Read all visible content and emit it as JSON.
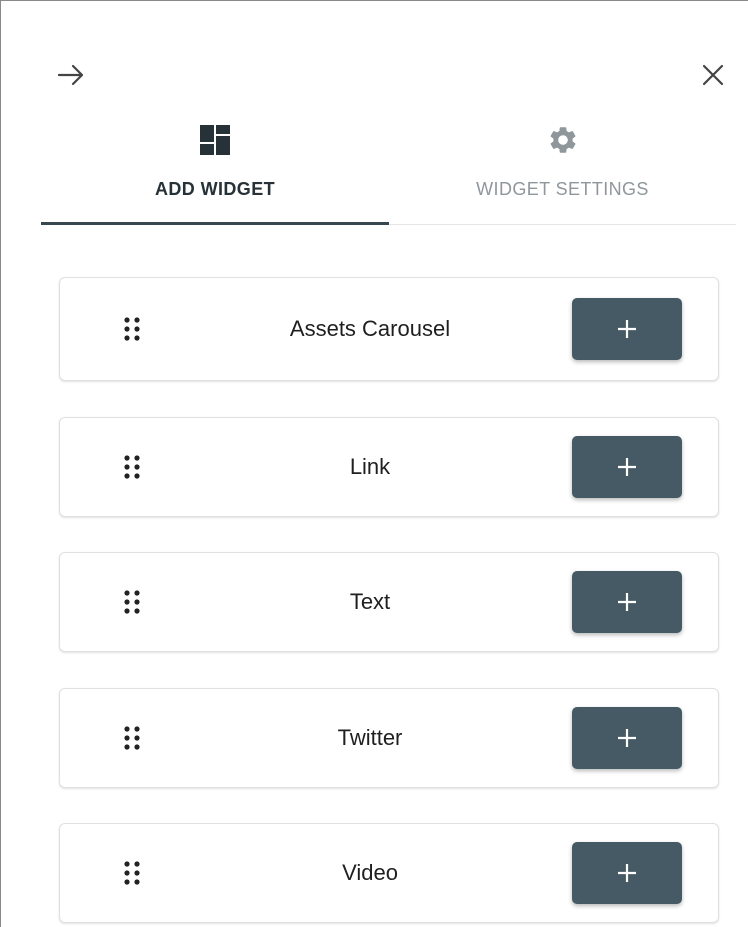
{
  "header": {
    "collapse_icon": "arrow-right-icon",
    "close_icon": "close-icon"
  },
  "tabs": [
    {
      "label": "ADD WIDGET",
      "icon": "dashboard-icon",
      "active": true
    },
    {
      "label": "WIDGET SETTINGS",
      "icon": "gear-icon",
      "active": false
    }
  ],
  "widgets": [
    {
      "name": "Assets Carousel",
      "add_label": "+"
    },
    {
      "name": "Link",
      "add_label": "+"
    },
    {
      "name": "Text",
      "add_label": "+"
    },
    {
      "name": "Twitter",
      "add_label": "+"
    },
    {
      "name": "Video",
      "add_label": "+"
    }
  ],
  "colors": {
    "accent": "#37474f",
    "add_button": "#455a64",
    "inactive_tab_text": "#8f979c",
    "active_tab_text": "#263238"
  }
}
